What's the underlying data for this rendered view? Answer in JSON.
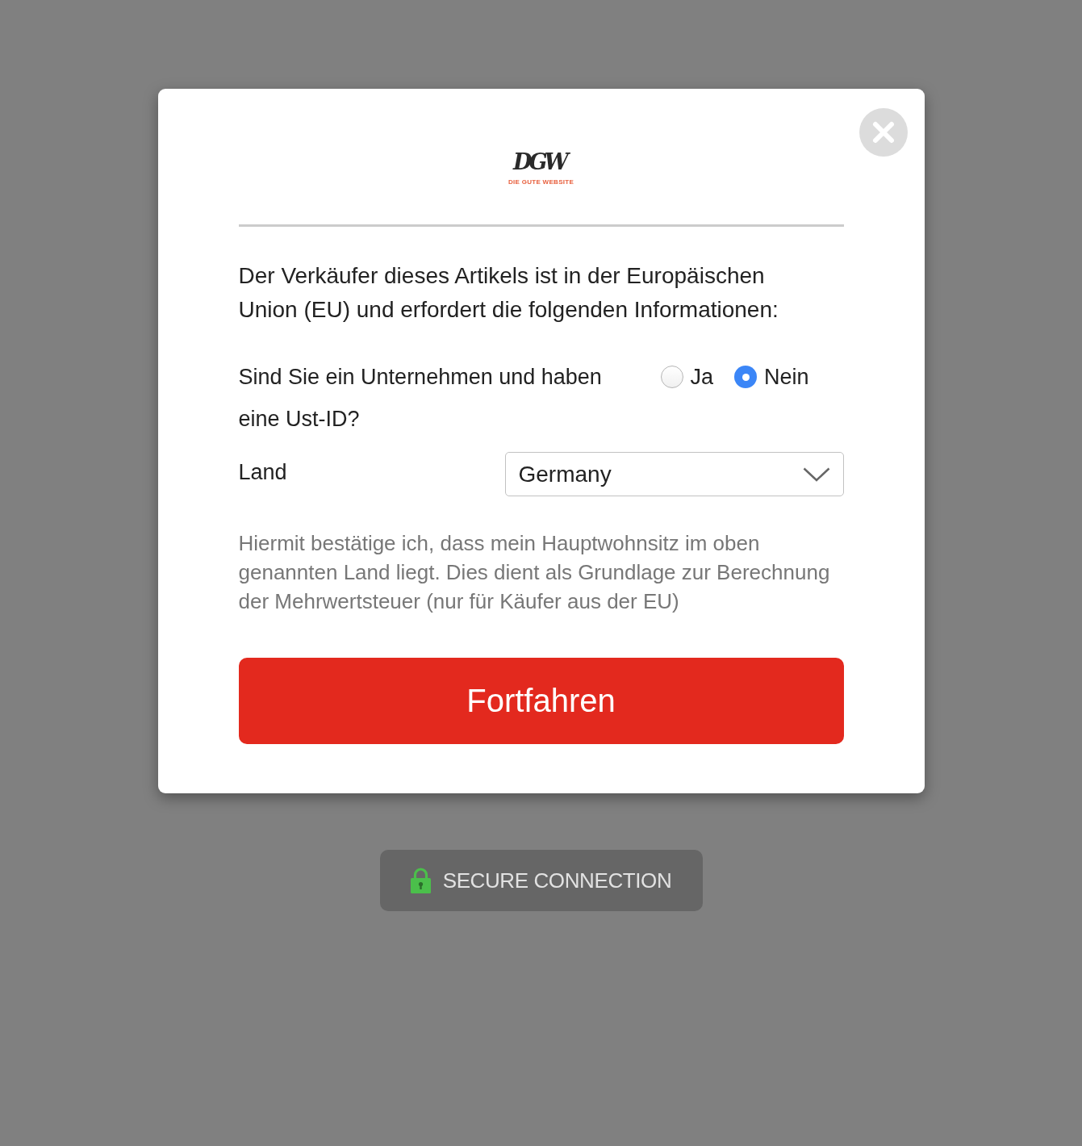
{
  "logo": {
    "mark": "DGW",
    "tagline": "DIE GUTE WEBSITE"
  },
  "intro": "Der Verkäufer dieses Artikels ist in der Europäischen Union (EU) und erfordert die folgenden Informationen:",
  "vat_question": {
    "label": "Sind Sie ein Unternehmen und haben eine Ust-ID?",
    "options": [
      {
        "label": "Ja",
        "selected": false
      },
      {
        "label": "Nein",
        "selected": true
      }
    ]
  },
  "country": {
    "label": "Land",
    "value": "Germany"
  },
  "notice": "Hiermit bestätige ich, dass mein Hauptwohnsitz im oben genannten Land liegt. Dies dient als Grundlage zur Berechnung der Mehrwertsteuer (nur für Käufer aus der EU)",
  "submit_button": "Fortfahren",
  "security_badge": "SECURE CONNECTION"
}
